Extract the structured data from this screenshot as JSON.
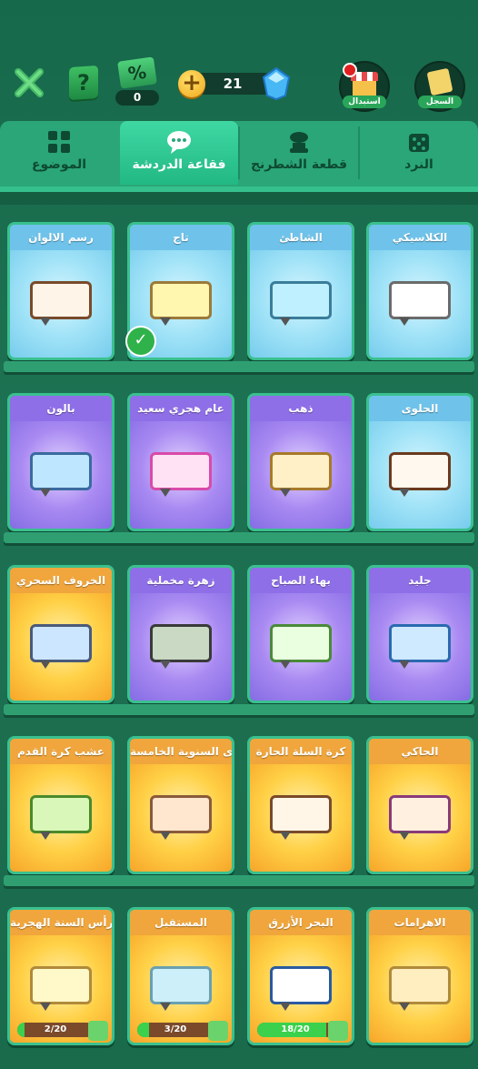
{
  "header": {
    "coupon_count": "0",
    "coupon_symbol": "%",
    "gem_count": "21",
    "help_symbol": "?",
    "plus_symbol": "+",
    "shop_label": "استبدال",
    "history_label": "السجل"
  },
  "tabs": [
    {
      "label": "النرد",
      "icon": "dice-icon",
      "active": false
    },
    {
      "label": "قطعة الشطرنج",
      "icon": "chess-piece-icon",
      "active": false
    },
    {
      "label": "فقاعة الدردشة",
      "icon": "chat-bubble-icon",
      "active": true
    },
    {
      "label": "الموضوع",
      "icon": "grid-icon",
      "active": false
    }
  ],
  "cards": [
    {
      "title": "الكلاسيكي",
      "theme": "blue",
      "bubble_color": "#ffffff",
      "border": "#6b6b6b"
    },
    {
      "title": "الشاطئ",
      "theme": "blue",
      "bubble_color": "#bff0ff",
      "border": "#3a7d9a"
    },
    {
      "title": "تاج",
      "theme": "blue",
      "bubble_color": "#fff6b0",
      "border": "#9b7a3a",
      "selected": true
    },
    {
      "title": "رسم الالوان",
      "theme": "blue",
      "bubble_color": "#fff4e8",
      "border": "#7a4a2a"
    },
    {
      "title": "الحلوى",
      "theme": "blue",
      "bubble_color": "#fff8ef",
      "border": "#6b3a1e"
    },
    {
      "title": "ذهب",
      "theme": "purple",
      "bubble_color": "#fff0c8",
      "border": "#a77a2a"
    },
    {
      "title": "عام هجري سعيد",
      "theme": "purple",
      "bubble_color": "#ffe2f4",
      "border": "#d84aa9"
    },
    {
      "title": "بالون",
      "theme": "purple",
      "bubble_color": "#bfe6ff",
      "border": "#3a6aa0"
    },
    {
      "title": "جليد",
      "theme": "purple",
      "bubble_color": "#cfeaff",
      "border": "#2a6ab0"
    },
    {
      "title": "بهاء الصباح",
      "theme": "purple",
      "bubble_color": "#e9ffe0",
      "border": "#4a8a3a"
    },
    {
      "title": "زهرة مخملية",
      "theme": "purple",
      "bubble_color": "#c9d9c4",
      "border": "#3a3a3a"
    },
    {
      "title": "الخروف السحري",
      "theme": "orange",
      "bubble_color": "#cde6ff",
      "border": "#4a5a7a"
    },
    {
      "title": "الحاكي",
      "theme": "orange",
      "bubble_color": "#fff0e0",
      "border": "#8a3a7a"
    },
    {
      "title": "كرة السلة الحارة",
      "theme": "orange",
      "bubble_color": "#fff6e8",
      "border": "#7a4a2a"
    },
    {
      "title": "الذكرى السنوية الخامسة",
      "theme": "orange",
      "bubble_color": "#ffe7cf",
      "border": "#8a5a3a"
    },
    {
      "title": "عشب كرة القدم",
      "theme": "orange",
      "bubble_color": "#d9f7b8",
      "border": "#4a8a2a"
    },
    {
      "title": "الاهرامات",
      "theme": "orange",
      "bubble_color": "#ffeec0",
      "border": "#b08a3a"
    },
    {
      "title": "البحر الأزرق",
      "theme": "orange",
      "bubble_color": "#ffffff",
      "border": "#2a5aa0",
      "progress_text": "18/20",
      "progress": 0.9
    },
    {
      "title": "المستقبل",
      "theme": "orange",
      "bubble_color": "#cdeffa",
      "border": "#6aa0b0",
      "progress_text": "3/20",
      "progress": 0.15
    },
    {
      "title": "رأس السنة الهجرية",
      "theme": "orange",
      "bubble_color": "#fff8c8",
      "border": "#b08a3a",
      "progress_text": "2/20",
      "progress": 0.1
    }
  ]
}
